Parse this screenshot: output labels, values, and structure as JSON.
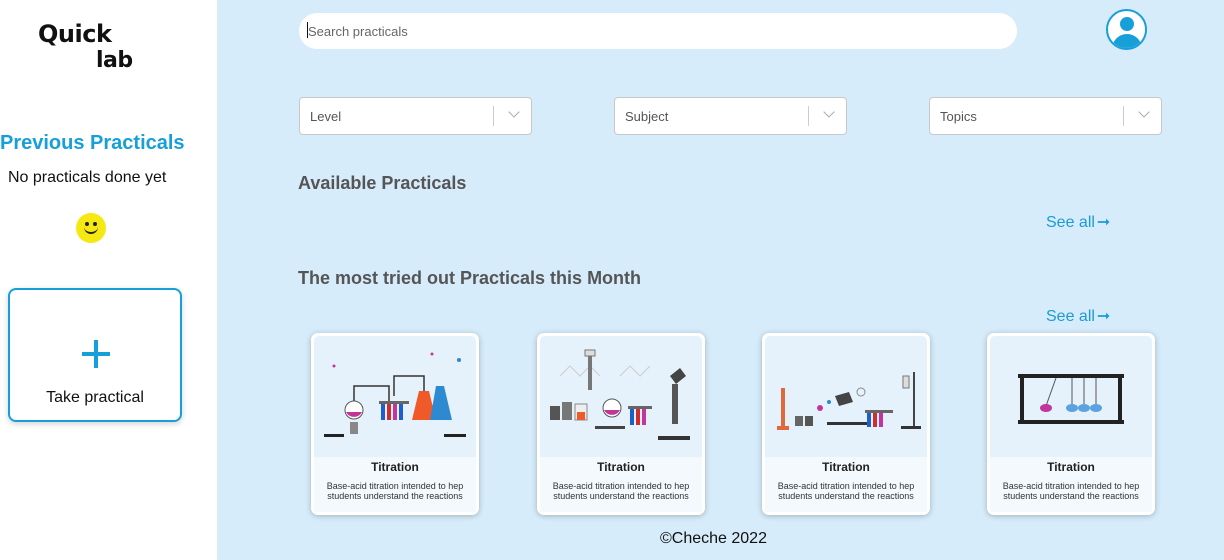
{
  "logo": {
    "line1": "Quick",
    "line2": "lab"
  },
  "sidebar": {
    "previous_title": "Previous Practicals",
    "previous_empty": "No practicals done yet",
    "take_practical_label": "Take practical"
  },
  "search": {
    "placeholder": "Search practicals",
    "value": ""
  },
  "filters": [
    {
      "label": "Level"
    },
    {
      "label": "Subject"
    },
    {
      "label": "Topics"
    }
  ],
  "sections": {
    "available": {
      "title": "Available Practicals",
      "see_all": "See all"
    },
    "most_tried": {
      "title": "The most tried out Practicals this Month",
      "see_all": "See all"
    }
  },
  "cards": [
    {
      "title": "Titration",
      "description": "Base-acid titration intended to hep students understand the reactions"
    },
    {
      "title": "Titration",
      "description": "Base-acid titration intended to hep students understand the reactions"
    },
    {
      "title": "Titration",
      "description": "Base-acid titration intended to hep students understand the reactions"
    },
    {
      "title": "Titration",
      "description": "Base-acid titration intended to hep students understand the reactions"
    }
  ],
  "footer": {
    "text": "©Cheche 2022"
  },
  "colors": {
    "accent": "#179fd9",
    "background": "#d6ecfa",
    "smiley": "#f5e911"
  }
}
